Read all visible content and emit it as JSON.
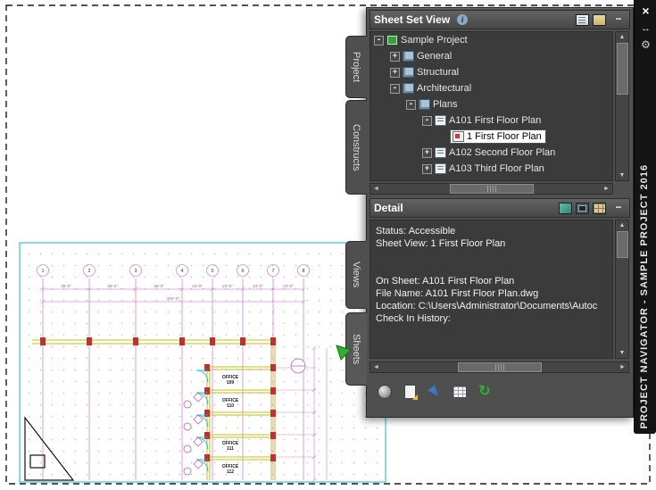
{
  "strip": {
    "title": "PROJECT NAVIGATOR - SAMPLE PROJECT 2016",
    "close": "×",
    "autohide": "↔",
    "menu": "⚙"
  },
  "tabs": [
    "Project",
    "Constructs",
    "Views",
    "Sheets"
  ],
  "sheet_set_view": {
    "title": "Sheet Set View",
    "info": "i",
    "minimize": "−",
    "tree": [
      {
        "label": "Sample Project",
        "expander": "-"
      },
      {
        "label": "General",
        "expander": "+"
      },
      {
        "label": "Structural",
        "expander": "+"
      },
      {
        "label": "Architectural",
        "expander": "-"
      },
      {
        "label": "Plans",
        "expander": "-"
      },
      {
        "label": "A101 First Floor Plan",
        "expander": "-"
      },
      {
        "label": "1 First Floor Plan",
        "expander": ""
      },
      {
        "label": "A102 Second Floor Plan",
        "expander": "+"
      },
      {
        "label": "A103 Third Floor Plan",
        "expander": "+"
      }
    ]
  },
  "detail": {
    "title": "Detail",
    "minimize": "−",
    "lines": [
      "Status: Accessible",
      "Sheet View: 1 First Floor Plan",
      "",
      "",
      "On Sheet: A101 First Floor Plan",
      "File Name: A101 First Floor Plan.dwg",
      "Location: C:\\Users\\Administrator\\Documents\\Autoc",
      "Check In History:"
    ]
  },
  "scroll": {
    "up": "▲",
    "down": "▼",
    "left": "◄",
    "right": "►"
  },
  "toolbar": {
    "refresh_glyph": "↻"
  },
  "drawing": {
    "grid_bubbles": [
      "1",
      "2",
      "3",
      "4",
      "5",
      "6",
      "7",
      "8"
    ],
    "dims": [
      "36'-0\"",
      "36'-0\"",
      "36'-0\"",
      "24'-0\"",
      "24'-0\"",
      "24'-0\"",
      "24'-0\""
    ],
    "overall_dim": "204'-0\"",
    "rooms": [
      {
        "line1": "OFFICE",
        "line2": "109"
      },
      {
        "line1": "OFFICE",
        "line2": "110"
      },
      {
        "line1": "OFFICE",
        "line2": "111"
      },
      {
        "line1": "OFFICE",
        "line2": "112"
      }
    ]
  },
  "colors": {
    "accent_green": "#2fae2f",
    "grid_magenta": "#c060c8",
    "wall_yellow": "#c2c21a",
    "viewport_cyan": "#19b7c9"
  }
}
